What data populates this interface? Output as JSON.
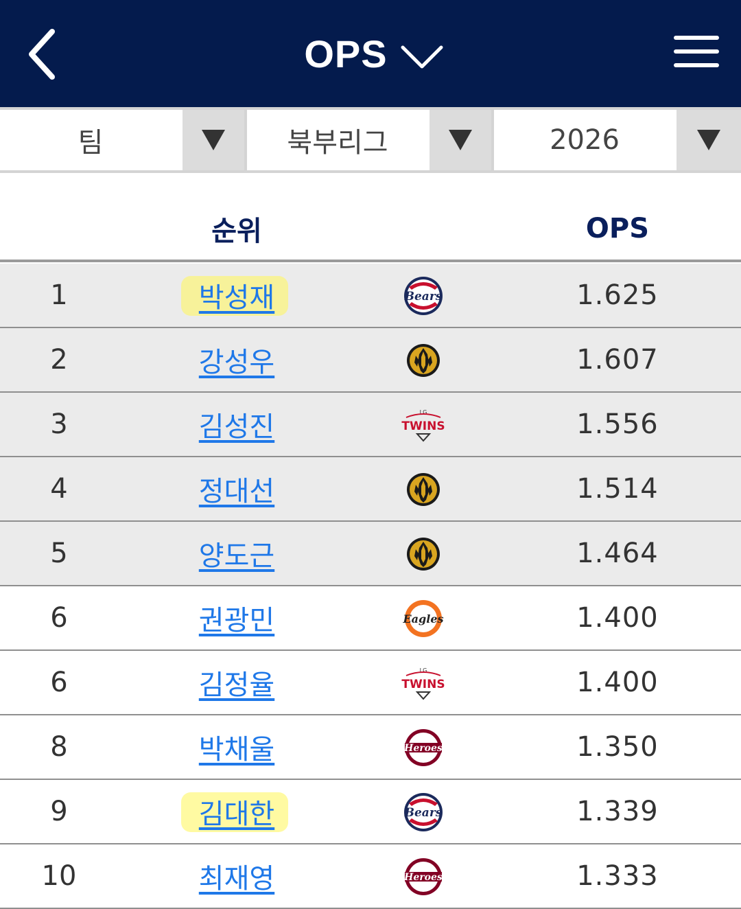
{
  "header": {
    "title": "OPS",
    "back_icon": "chevron-left-icon",
    "menu_icon": "hamburger-menu-icon",
    "background_color": "#041b4d"
  },
  "filters": [
    {
      "value": "팀"
    },
    {
      "value": "북부리그"
    },
    {
      "value": "2026"
    }
  ],
  "table": {
    "headers": {
      "rank": "순위",
      "ops": "OPS"
    },
    "rows": [
      {
        "rank": "1",
        "name": "박성재",
        "team_logo": "bears",
        "ops": "1.625",
        "highlighted": true
      },
      {
        "rank": "2",
        "name": "강성우",
        "team_logo": "gold-circle",
        "ops": "1.607",
        "highlighted": false
      },
      {
        "rank": "3",
        "name": "김성진",
        "team_logo": "twins",
        "ops": "1.556",
        "highlighted": false
      },
      {
        "rank": "4",
        "name": "정대선",
        "team_logo": "gold-circle",
        "ops": "1.514",
        "highlighted": false
      },
      {
        "rank": "5",
        "name": "양도근",
        "team_logo": "gold-circle",
        "ops": "1.464",
        "highlighted": false
      },
      {
        "rank": "6",
        "name": "권광민",
        "team_logo": "eagles",
        "ops": "1.400",
        "highlighted": false
      },
      {
        "rank": "6",
        "name": "김정율",
        "team_logo": "twins",
        "ops": "1.400",
        "highlighted": false
      },
      {
        "rank": "8",
        "name": "박채울",
        "team_logo": "heroes",
        "ops": "1.350",
        "highlighted": false
      },
      {
        "rank": "9",
        "name": "김대한",
        "team_logo": "bears",
        "ops": "1.339",
        "highlighted": true
      },
      {
        "rank": "10",
        "name": "최재영",
        "team_logo": "heroes",
        "ops": "1.333",
        "highlighted": false
      }
    ]
  },
  "logo_text": {
    "bears": "Bears",
    "twins": "TWINS",
    "twins_small": "LG",
    "eagles": "Eagles",
    "heroes": "Heroes"
  },
  "colors": {
    "link": "#1f78e8",
    "header_text": "#0a1f5c",
    "highlight": "#fff764",
    "shaded_row": "#ebebeb"
  }
}
